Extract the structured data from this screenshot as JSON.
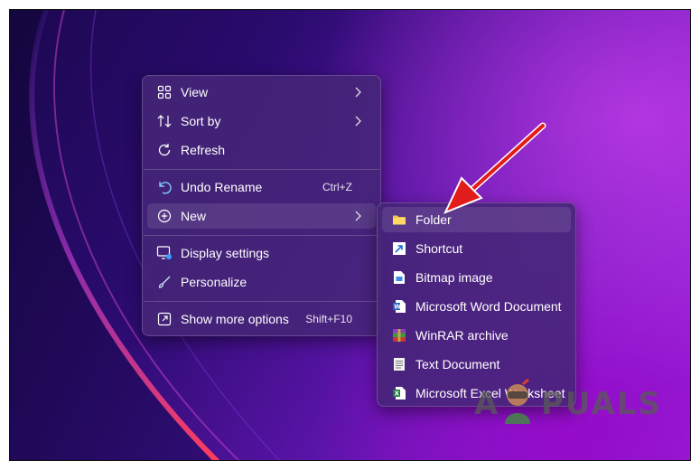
{
  "context_menu": {
    "items": [
      {
        "label": "View",
        "icon": "view-grid-icon",
        "has_submenu": true
      },
      {
        "label": "Sort by",
        "icon": "sort-icon",
        "has_submenu": true
      },
      {
        "label": "Refresh",
        "icon": "refresh-icon"
      },
      {
        "label": "Undo Rename",
        "icon": "undo-icon",
        "shortcut": "Ctrl+Z"
      },
      {
        "label": "New",
        "icon": "new-plus-icon",
        "has_submenu": true,
        "highlighted": true
      },
      {
        "label": "Display settings",
        "icon": "display-settings-icon"
      },
      {
        "label": "Personalize",
        "icon": "brush-icon"
      },
      {
        "label": "Show more options",
        "icon": "show-more-icon",
        "shortcut": "Shift+F10"
      }
    ]
  },
  "new_submenu": {
    "items": [
      {
        "label": "Folder",
        "icon": "folder-icon",
        "highlighted": true
      },
      {
        "label": "Shortcut",
        "icon": "shortcut-icon"
      },
      {
        "label": "Bitmap image",
        "icon": "bitmap-icon"
      },
      {
        "label": "Microsoft Word Document",
        "icon": "word-icon"
      },
      {
        "label": "WinRAR archive",
        "icon": "winrar-icon"
      },
      {
        "label": "Text Document",
        "icon": "text-document-icon"
      },
      {
        "label": "Microsoft Excel Worksheet",
        "icon": "excel-icon"
      }
    ]
  },
  "annotation": {
    "arrow_color": "#e21b1b",
    "points_to": "Folder"
  },
  "watermark": {
    "text_a": "A",
    "text_rest": "PUALS"
  },
  "colors": {
    "menu_bg": "#46267a",
    "text": "#ffffff",
    "highlight": "rgba(255,255,255,0.10)"
  }
}
